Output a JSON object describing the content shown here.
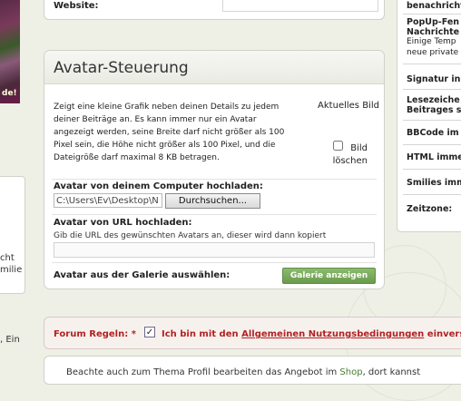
{
  "left": {
    "photo_text": "de!",
    "fragments": [
      "cht",
      "milie",
      ", Ein"
    ]
  },
  "website": {
    "label": "Website:"
  },
  "avatar": {
    "title": "Avatar-Steuerung",
    "description": "Zeigt eine kleine Grafik neben deinen Details zu jedem deiner Beiträge an. Es kann immer nur ein Avatar angezeigt werden, seine Breite darf nicht größer als 100 Pixel sein, die Höhe nicht größer als 100 Pixel, und die Dateigröße darf maximal 8 KB betragen.",
    "current_label": "Aktuelles Bild",
    "delete_label": "Bild löschen",
    "upload_label": "Avatar von deinem Computer hochladen:",
    "file_path": "C:\\Users\\Ev\\Desktop\\N",
    "browse_button": "Durchsuchen...",
    "url_label": "Avatar von URL hochladen:",
    "url_hint": "Gib die URL des gewünschten Avatars an, dieser wird dann kopiert",
    "url_value": "",
    "gallery_label": "Avatar aus der Galerie auswählen:",
    "gallery_button": "Galerie anzeigen"
  },
  "rules": {
    "label": "Forum Regeln: *",
    "checkbox": "✓",
    "text_before": "Ich bin mit den",
    "link": "Allgemeinen Nutzungsbedingungen",
    "text_after": "einvers"
  },
  "bottom": {
    "text_before": "Beachte auch zum Thema Profil bearbeiten das Angebot im",
    "link": "Shop",
    "text_after": ", dort kannst"
  },
  "sidebar": {
    "items": [
      {
        "title": "benachrichtig",
        "sub": ""
      },
      {
        "title": "PopUp-Fen",
        "title2": "Nachrichte",
        "sub": "Einige Temp",
        "sub2": "neue private"
      },
      {
        "title": "Signatur in"
      },
      {
        "title": "Lesezeiche",
        "title2": "Beitrages s"
      },
      {
        "title": "BBCode im"
      },
      {
        "title": "HTML imme"
      },
      {
        "title": "Smilies imm"
      },
      {
        "title": "Zeitzone:"
      }
    ]
  }
}
